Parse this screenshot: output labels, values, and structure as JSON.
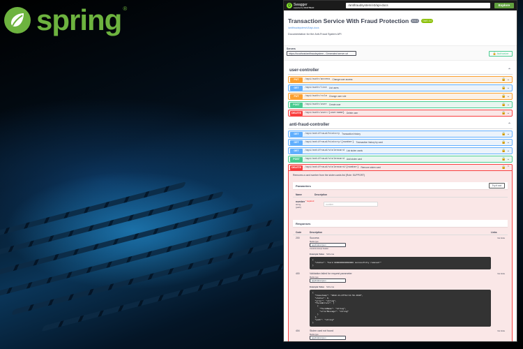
{
  "brand": {
    "name": "spring",
    "tm": "®"
  },
  "topbar": {
    "logo_text": "Swagger",
    "logo_sub": "supported by SMARTBEAR",
    "url": "/antifraudsystem/v3/api-docs",
    "explore": "Explore"
  },
  "info": {
    "title": "Transaction Service With Fraud Protection",
    "version": "0.0.1",
    "oas": "OAS 3.0",
    "link": "/antifraudsystem/v3/api-docs",
    "description": "Documentation for the Anti-Fraud System API"
  },
  "servers": {
    "label": "Servers",
    "selected": "https://localhost/antifraudsystem - Generated server url",
    "authorize": "Authorize"
  },
  "tags": [
    {
      "name": "user-controller",
      "ops": [
        {
          "method": "PUT",
          "cls": "put",
          "path": "/api/auth/access",
          "summary": "Change user access"
        },
        {
          "method": "GET",
          "cls": "get",
          "path": "/api/auth/list",
          "summary": "List users"
        },
        {
          "method": "PUT",
          "cls": "put",
          "path": "/api/auth/role",
          "summary": "Change user role"
        },
        {
          "method": "POST",
          "cls": "post",
          "path": "/api/auth/user",
          "summary": "Create user"
        },
        {
          "method": "DELETE",
          "cls": "del",
          "path": "/api/auth/user/{username}",
          "summary": "Delete user"
        }
      ]
    },
    {
      "name": "anti-fraud-controller",
      "ops": [
        {
          "method": "GET",
          "cls": "get",
          "path": "/api/antifraud/history",
          "summary": "Transaction history"
        },
        {
          "method": "GET",
          "cls": "get",
          "path": "/api/antifraud/history/{number}",
          "summary": "Transaction history by card"
        },
        {
          "method": "GET",
          "cls": "get",
          "path": "/api/antifraud/stolencard",
          "summary": "List stolen cards"
        },
        {
          "method": "POST",
          "cls": "post",
          "path": "/api/antifraud/stolencard",
          "summary": "Add stolen card"
        },
        {
          "method": "DELETE",
          "cls": "del",
          "path": "/api/antifraud/stolencard/{number}",
          "summary": "Remove stolen card"
        }
      ]
    }
  ],
  "opened": {
    "description": "Removes a card number from the stolen cards list (Role: SUPPORT)",
    "parameters_title": "Parameters",
    "try_button": "Try it out",
    "param_col_name": "Name",
    "param_col_desc": "Description",
    "param_name": "number",
    "param_required": "* required",
    "param_type": "string",
    "param_in": "(path)",
    "param_placeholder": "number",
    "responses_title": "Responses",
    "resp_col_code": "Code",
    "resp_col_desc": "Description",
    "resp_col_links": "Links",
    "media_label": "Media type",
    "media_value": "application/json",
    "media_note": "Controls Accept header.",
    "example_value": "Example Value",
    "schema": "Schema",
    "responses": [
      {
        "code": "200",
        "desc": "Success",
        "links": "No links",
        "example": "{\n  \"status\": \"Card 0000000000000000 successfully removed!\"\n}"
      },
      {
        "code": "400",
        "desc": "Validation failed for request parameter",
        "links": "No links",
        "example": "{\n  \"timestamp\": \"2022-11-07T12:11:58.164Z\",\n  \"status\": 0,\n  \"error\": \"string\",\n  \"fieldErrors\": [\n    {\n      \"fieldName\": \"string\",\n      \"errorMessage\": \"string\"\n    }\n  ],\n  \"path\": \"string\"\n}"
      },
      {
        "code": "404",
        "desc": "Stolen card not found",
        "links": "No links",
        "example": ""
      }
    ]
  }
}
